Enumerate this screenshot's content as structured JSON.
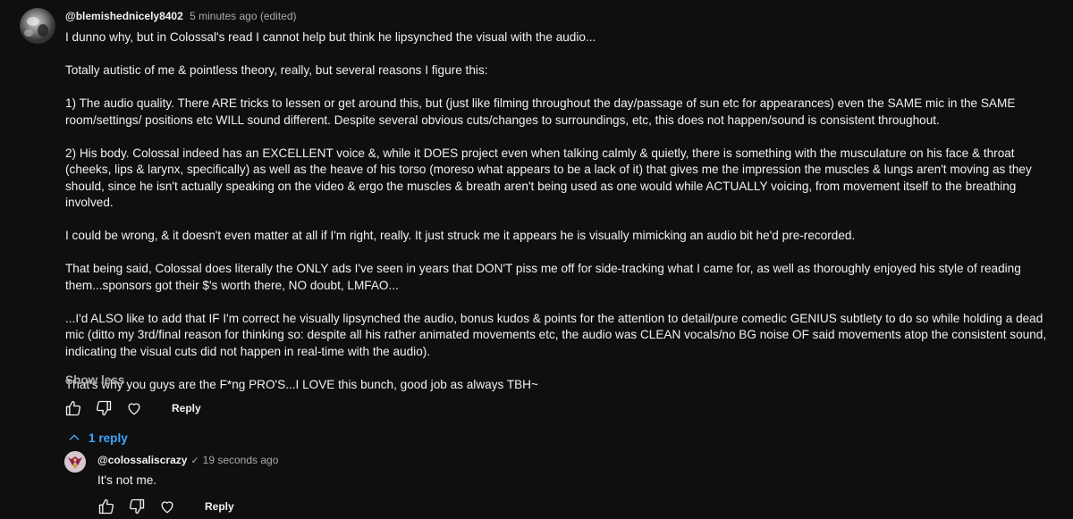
{
  "comment": {
    "author": "@blemishednicely8402",
    "time": "5 minutes ago (edited)",
    "paragraphs": [
      "I dunno why, but in Colossal's read I cannot help but think he lipsynched the visual with the audio...",
      "Totally autistic of me & pointless theory, really, but several reasons I figure this:",
      "1) The audio quality. There ARE tricks to lessen or get around this, but (just like filming throughout the day/passage of sun etc for appearances) even the SAME mic in the SAME room/settings/ positions etc WILL sound different. Despite several obvious cuts/changes to surroundings, etc, this does not happen/sound is consistent throughout.",
      "2) His body. Colossal indeed has an EXCELLENT voice &, while it DOES project even when talking calmly & quietly, there is something with the musculature on his face & throat (cheeks, lips & larynx, specifically) as well as the heave of his torso (moreso what appears to be a lack of it) that gives me the impression the muscles & lungs aren't moving as they should, since he isn't actually speaking on the video & ergo the muscles & breath aren't being used as one would while ACTUALLY voicing, from movement itself to the breathing involved.",
      "I could be wrong, & it doesn't even matter at all if I'm right, really. It just struck me it appears he is visually mimicking an audio bit he'd pre-recorded.",
      "That being said, Colossal does literally the ONLY ads I've seen in years that DON'T piss me off for side-tracking what I came for, as well as thoroughly enjoyed his style of reading them...sponsors got their $'s worth there, NO doubt, LMFAO...",
      "...I'd ALSO like to add that IF I'm correct he visually lipsynched the audio, bonus kudos & points for the attention to detail/pure comedic GENIUS subtlety to do so while holding a dead mic (ditto my 3rd/final reason for thinking so: despite all his rather animated movements etc, the audio was CLEAN vocals/no BG noise OF said movements atop the consistent sound, indicating the visual cuts did not happen in real-time with the audio).",
      "That's why you guys are the F*ng PRO'S...I LOVE this bunch, good job as always TBH~"
    ],
    "show_less": "Show less",
    "reply_label": "Reply",
    "replies_toggle": "1 reply"
  },
  "reply": {
    "author": "@colossaliscrazy",
    "verified_icon": "checkmark-icon",
    "time": "19 seconds ago",
    "text": "It's not me.",
    "reply_label": "Reply"
  }
}
